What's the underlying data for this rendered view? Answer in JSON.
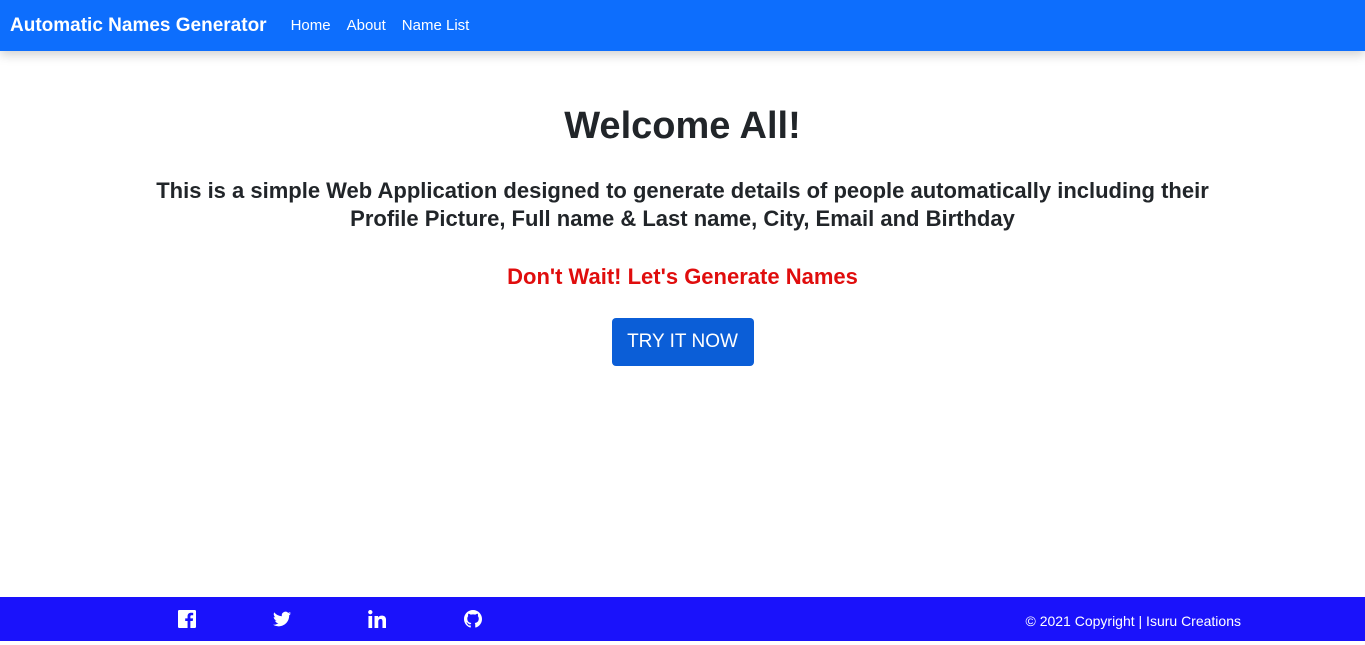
{
  "navbar": {
    "brand": "Automatic Names Generator",
    "links": [
      "Home",
      "About",
      "Name List"
    ],
    "color": "#0d6efd"
  },
  "main": {
    "title": "Welcome All!",
    "description": "This is a simple Web Application designed to generate details of people automatically including their Profile Picture, Full name & Last name, City, Email and Birthday",
    "cta_text": "Don't Wait! Let's Generate Names",
    "cta_color": "#e00d0d",
    "button_label": "TRY IT NOW",
    "button_color": "#0b5ed7"
  },
  "footer": {
    "color": "#1a12fb",
    "social_icons": [
      "facebook-icon",
      "twitter-icon",
      "linkedin-icon",
      "github-icon"
    ],
    "copyright": "© 2021 Copyright | Isuru Creations"
  }
}
